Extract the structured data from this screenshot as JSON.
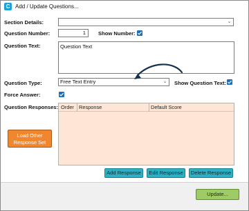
{
  "window": {
    "title": "Add / Update Questions...",
    "icon": "app-c-icon"
  },
  "form": {
    "section_details_label": "Section Details:",
    "section_details_value": "",
    "question_number_label": "Question Number:",
    "question_number_value": "1",
    "show_number_label": "Show Number:",
    "show_number_checked": true,
    "question_text_label": "Question Text:",
    "question_text_value": "Question Text",
    "question_type_label": "Question Type:",
    "question_type_value": "Free Text Entry",
    "show_question_text_label": "Show Question Text:",
    "show_question_text_checked": true,
    "force_answer_label": "Force Answer:",
    "force_answer_checked": true,
    "question_responses_label": "Question Responses:"
  },
  "responses_grid": {
    "columns": [
      "Order",
      "Response",
      "Default Score"
    ],
    "rows": []
  },
  "buttons": {
    "load_other_line1": "Load Other",
    "load_other_line2": "Response Set",
    "add_response": "Add Response",
    "edit_response": "Edit Response",
    "delete_response": "Delete Response",
    "update": "Update..."
  },
  "colors": {
    "accent_blue": "#1f6fb8",
    "orange_button": "#f0862e",
    "teal_button": "#2bb0c4",
    "green_button": "#9fcb66",
    "grid_background": "#fde6d6"
  }
}
